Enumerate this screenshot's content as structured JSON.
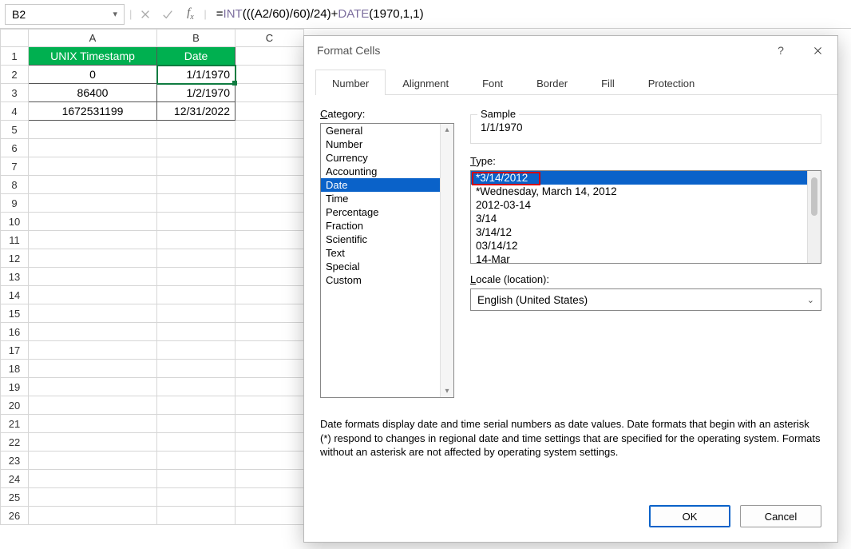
{
  "formulaBar": {
    "cellRef": "B2",
    "formulaPrefix": "=",
    "fn1": "INT",
    "mid": "(((A2/60)/60)/24)+",
    "fn2": "DATE",
    "tail": "(1970,1,1)"
  },
  "sheet": {
    "cols": [
      "A",
      "B",
      "C"
    ],
    "rows": [
      "1",
      "2",
      "3",
      "4",
      "5",
      "6",
      "7",
      "8",
      "9",
      "10",
      "11",
      "12",
      "13",
      "14",
      "15",
      "16",
      "17",
      "18",
      "19",
      "20",
      "21",
      "22",
      "23",
      "24",
      "25",
      "26"
    ],
    "headers": {
      "A": "UNIX Timestamp",
      "B": "Date"
    },
    "data": [
      {
        "A": "0",
        "B": "1/1/1970"
      },
      {
        "A": "86400",
        "B": "1/2/1970"
      },
      {
        "A": "1672531199",
        "B": "12/31/2022"
      }
    ]
  },
  "dialog": {
    "title": "Format Cells",
    "help": "?",
    "tabs": [
      "Number",
      "Alignment",
      "Font",
      "Border",
      "Fill",
      "Protection"
    ],
    "activeTab": 0,
    "categoryLabel": "Category:",
    "categories": [
      "General",
      "Number",
      "Currency",
      "Accounting",
      "Date",
      "Time",
      "Percentage",
      "Fraction",
      "Scientific",
      "Text",
      "Special",
      "Custom"
    ],
    "categorySelected": "Date",
    "sampleLabel": "Sample",
    "sampleValue": "1/1/1970",
    "typeLabel": "Type:",
    "types": [
      "*3/14/2012",
      "*Wednesday, March 14, 2012",
      "2012-03-14",
      "3/14",
      "3/14/12",
      "03/14/12",
      "14-Mar"
    ],
    "typeSelected": "*3/14/2012",
    "localeLabel": "Locale (location):",
    "localeValue": "English (United States)",
    "description": "Date formats display date and time serial numbers as date values.  Date formats that begin with an asterisk (*) respond to changes in regional date and time settings that are specified for the operating system. Formats without an asterisk are not affected by operating system settings.",
    "ok": "OK",
    "cancel": "Cancel"
  }
}
